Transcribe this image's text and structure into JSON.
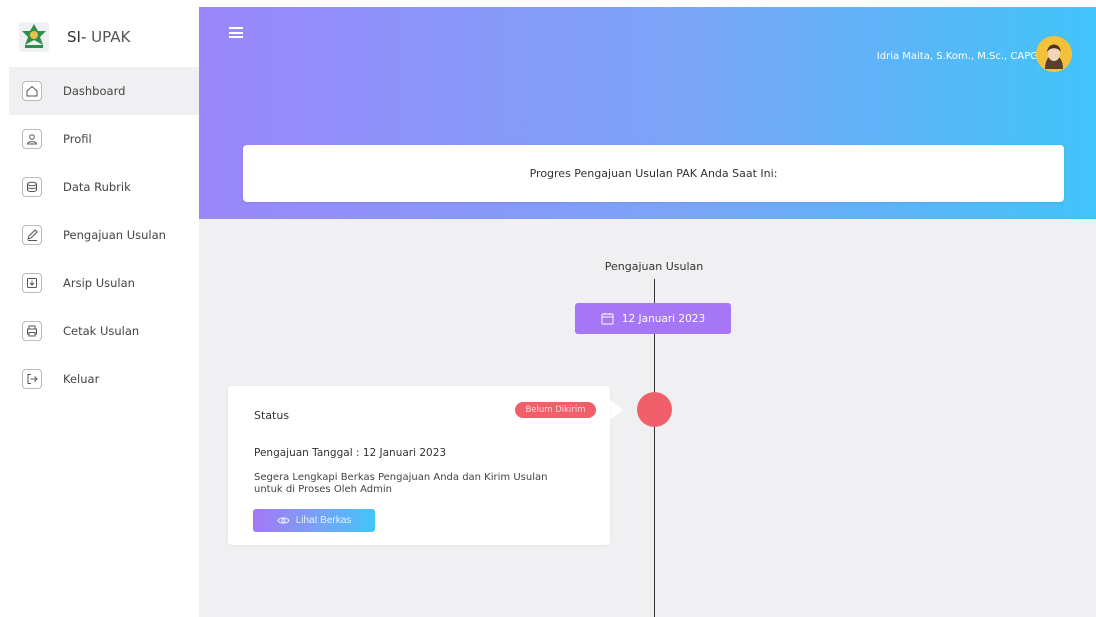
{
  "brand": {
    "name_prefix": "SI-",
    "name_suffix": " UPAK",
    "logo_icon": "emblem-icon"
  },
  "sidebar": {
    "items": [
      {
        "label": "Dashboard",
        "icon": "home-icon",
        "active": true
      },
      {
        "label": "Profil",
        "icon": "user-icon",
        "active": false
      },
      {
        "label": "Data Rubrik",
        "icon": "database-icon",
        "active": false
      },
      {
        "label": "Pengajuan Usulan",
        "icon": "pencil-icon",
        "active": false
      },
      {
        "label": "Arsip Usulan",
        "icon": "archive-icon",
        "active": false
      },
      {
        "label": "Cetak Usulan",
        "icon": "printer-icon",
        "active": false
      },
      {
        "label": "Keluar",
        "icon": "logout-icon",
        "active": false
      }
    ]
  },
  "header": {
    "menu_icon": "hamburger-icon",
    "user_name": "Idria Maita, S.Kom., M.Sc., CAPG"
  },
  "progress": {
    "heading": "Progres Pengajuan Usulan PAK Anda Saat Ini:"
  },
  "timeline": {
    "title": "Pengajuan Usulan",
    "date": "12 Januari 2023",
    "date_icon": "calendar-icon"
  },
  "status_card": {
    "title": "Status",
    "badge": "Belum Dikirim",
    "date_line": "Pengajuan Tanggal : 12 Januari 2023",
    "message": "Segera Lengkapi Berkas Pengajuan Anda dan Kirim Usulan untuk di Proses Oleh Admin",
    "button_label": "Lihat Berkas",
    "button_icon": "eye-icon"
  },
  "colors": {
    "gradient_start": "#9b87fb",
    "gradient_end": "#40c4f9",
    "date_pill": "#a576f5",
    "status_red": "#f1606a"
  }
}
